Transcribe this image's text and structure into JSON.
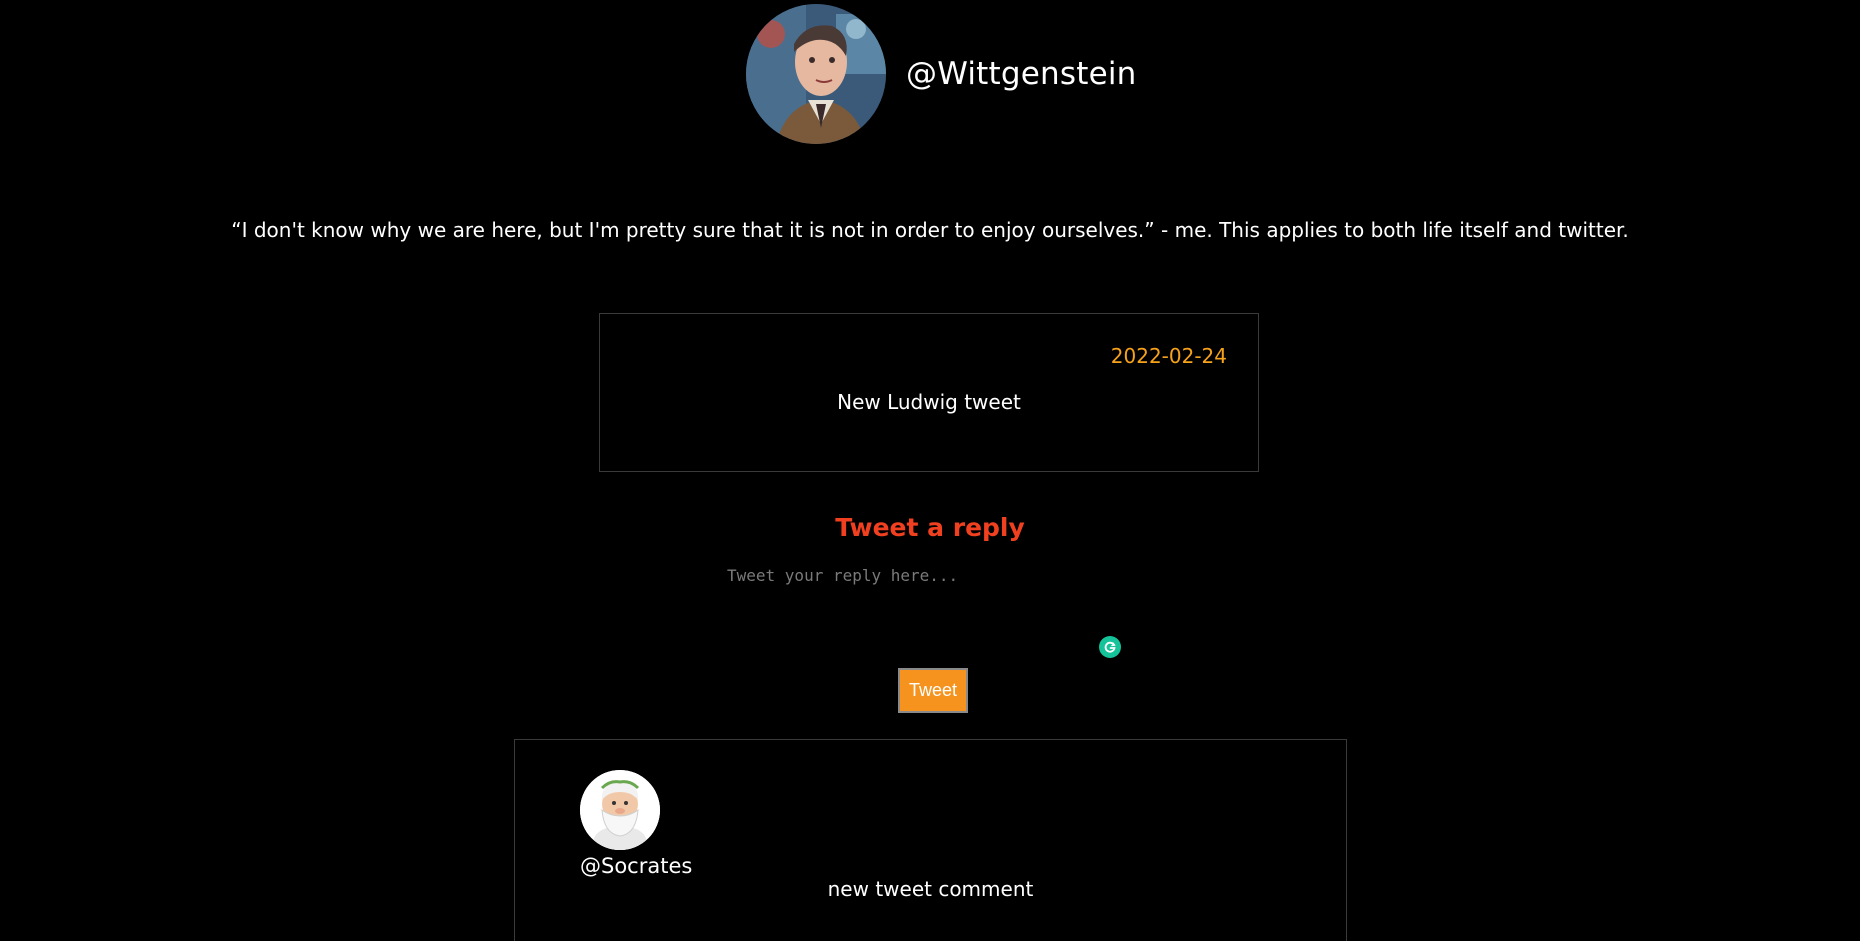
{
  "profile": {
    "username": "@Wittgenstein",
    "bio": "“I don't know why we are here, but I'm pretty sure that it is not in order to enjoy ourselves.” - me. This applies to both life itself and twitter."
  },
  "tweet": {
    "date": "2022-02-24",
    "text": "New Ludwig tweet"
  },
  "reply": {
    "heading": "Tweet a reply",
    "placeholder": "Tweet your reply here...",
    "button_label": "Tweet"
  },
  "comments": [
    {
      "username": "@Socrates",
      "text": "new tweet comment"
    }
  ],
  "colors": {
    "background": "#000000",
    "date": "#f7a21b",
    "heading": "#f1401f",
    "button": "#f6931e",
    "grammar_badge": "#15c39a"
  }
}
